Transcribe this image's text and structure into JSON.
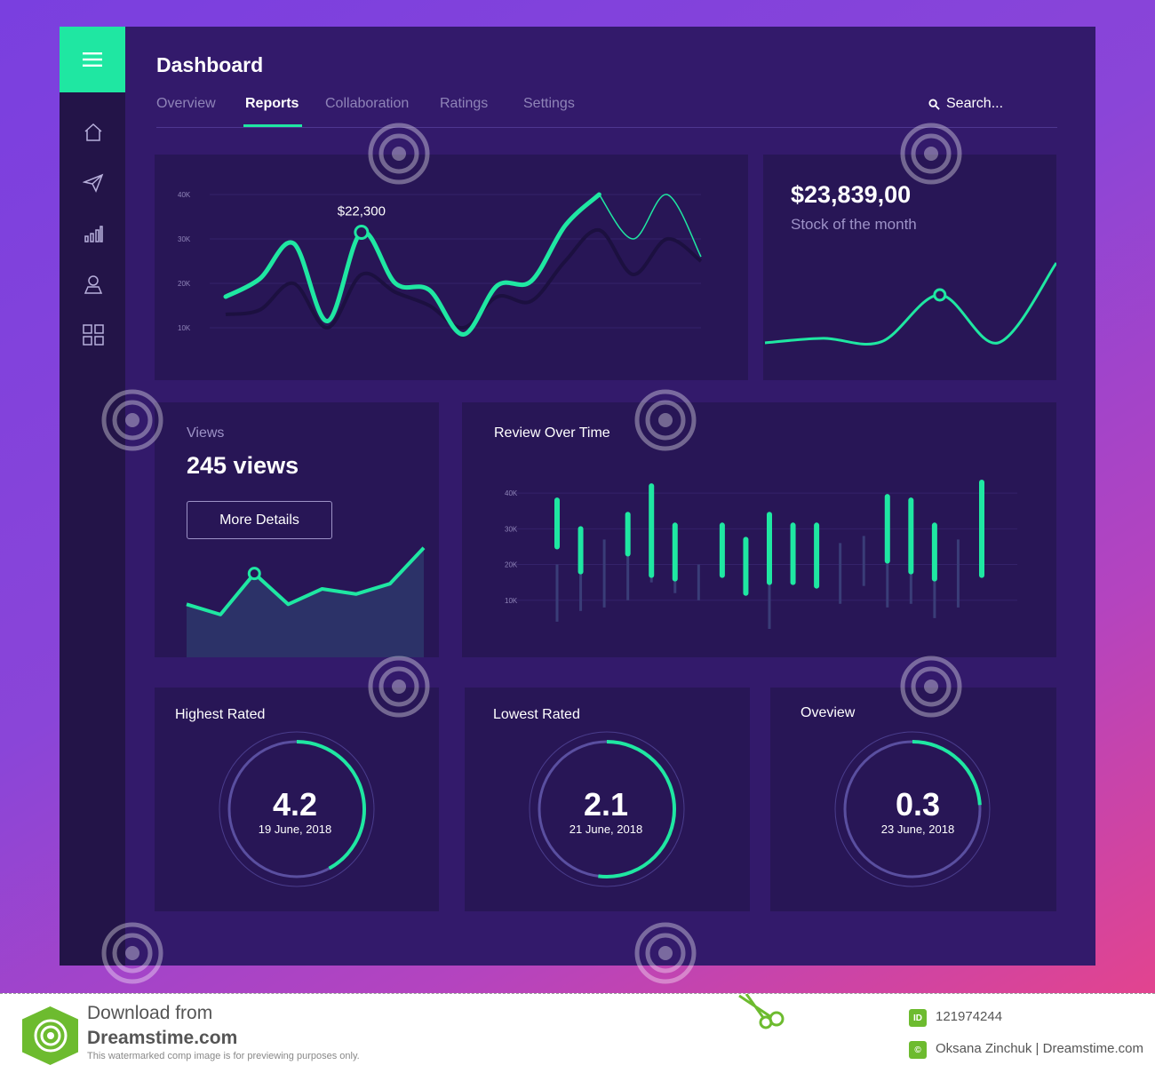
{
  "header": {
    "title": "Dashboard",
    "tabs": [
      {
        "label": "Overview",
        "active": false
      },
      {
        "label": "Reports",
        "active": true
      },
      {
        "label": "Collaboration",
        "active": false
      },
      {
        "label": "Ratings",
        "active": false
      },
      {
        "label": "Settings",
        "active": false
      }
    ],
    "search_placeholder": "Search..."
  },
  "sidebar": {
    "items": [
      {
        "icon": "home-icon"
      },
      {
        "icon": "send-icon"
      },
      {
        "icon": "bar-chart-icon"
      },
      {
        "icon": "user-icon"
      },
      {
        "icon": "grid-icon"
      }
    ]
  },
  "colors": {
    "accent": "#1fe7a2",
    "panel": "#331a6b",
    "card": "#281656",
    "sidebar": "#231448"
  },
  "cards": {
    "revenue_chart": {
      "annotation": "$22,300",
      "y_ticks": [
        "40K",
        "30K",
        "20K",
        "10K"
      ]
    },
    "stock": {
      "amount": "$23,839,00",
      "label": "Stock of the month"
    },
    "views": {
      "label": "Views",
      "value": "245 views",
      "button": "More Details"
    },
    "review": {
      "title": "Review Over Time",
      "y_ticks": [
        "40K",
        "30K",
        "20K",
        "10K"
      ]
    },
    "gauges": [
      {
        "title": "Highest Rated",
        "value": "4.2",
        "date": "19 June, 2018",
        "fraction": 0.42
      },
      {
        "title": "Lowest Rated",
        "value": "2.1",
        "date": "21 June, 2018",
        "fraction": 0.52
      },
      {
        "title": "Oveview",
        "value": "0.3",
        "date": "23 June, 2018",
        "fraction": 0.24
      }
    ]
  },
  "chart_data": [
    {
      "type": "line",
      "ylim": [
        0,
        45000
      ],
      "series": [
        {
          "values": [
            17000,
            21000,
            29000,
            11500,
            31500,
            20000,
            18500,
            8500,
            19500,
            20500,
            33000,
            40000,
            30000,
            40000,
            26000
          ]
        },
        {
          "values": [
            13000,
            14000,
            20000,
            10000,
            22000,
            18000,
            15000,
            10000,
            17000,
            16000,
            25000,
            32000,
            22000,
            30000,
            25000
          ]
        }
      ],
      "highlight": {
        "index": 4,
        "value": 22300
      }
    },
    {
      "type": "line",
      "series": [
        {
          "values": [
            1,
            1.2,
            1.05,
            3.1,
            1.0,
            4.5
          ]
        }
      ],
      "highlight": {
        "index": 3
      }
    },
    {
      "type": "area",
      "series": [
        {
          "values": [
            3,
            2,
            6,
            3,
            4.5,
            4,
            5,
            8.5
          ]
        }
      ],
      "highlight": {
        "index": 2
      }
    },
    {
      "type": "bar",
      "ylim": [
        0,
        45000
      ],
      "series": [
        {
          "values": [
            [
              25000,
              38000
            ],
            [
              18000,
              30000
            ],
            [
              0,
              0
            ],
            [
              23000,
              34000
            ],
            [
              17000,
              42000
            ],
            [
              16000,
              31000
            ],
            [
              0,
              0
            ],
            [
              17000,
              31000
            ],
            [
              12000,
              27000
            ],
            [
              15000,
              34000
            ],
            [
              15000,
              31000
            ],
            [
              14000,
              31000
            ],
            [
              0,
              0
            ],
            [
              0,
              0
            ],
            [
              21000,
              39000
            ],
            [
              18000,
              38000
            ],
            [
              16000,
              31000
            ],
            [
              0,
              0
            ],
            [
              17000,
              43000
            ]
          ]
        },
        {
          "values": [
            [
              4000,
              20000
            ],
            [
              7000,
              18000
            ],
            [
              8000,
              27000
            ],
            [
              10000,
              28000
            ],
            [
              15000,
              20000
            ],
            [
              12000,
              26000
            ],
            [
              10000,
              20000
            ],
            [
              0,
              0
            ],
            [
              0,
              0
            ],
            [
              2000,
              22000
            ],
            [
              0,
              0
            ],
            [
              0,
              0
            ],
            [
              9000,
              26000
            ],
            [
              14000,
              28000
            ],
            [
              8000,
              21000
            ],
            [
              9000,
              20000
            ],
            [
              5000,
              16000
            ],
            [
              8000,
              27000
            ],
            [
              0,
              0
            ]
          ]
        }
      ]
    }
  ]
}
